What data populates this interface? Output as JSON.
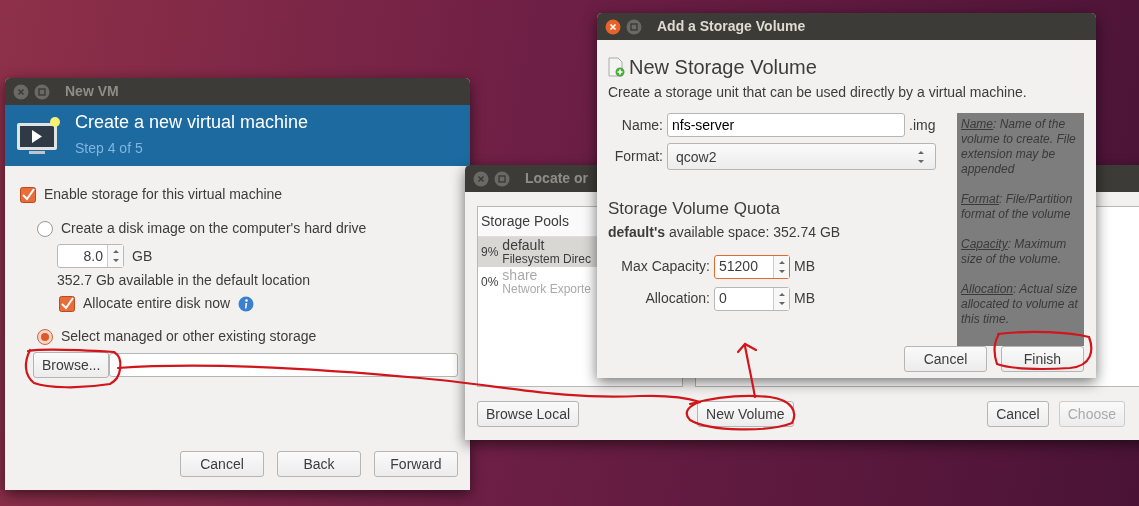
{
  "new_vm_window": {
    "title": "New VM",
    "active": false,
    "header": {
      "title": "Create a new virtual machine",
      "subtitle": "Step 4 of 5"
    },
    "enable_storage": {
      "label": "Enable storage for this virtual machine",
      "checked": true
    },
    "create_disk": {
      "label": "Create a disk image on the computer's hard drive",
      "selected": false
    },
    "disk_size": {
      "value": "8.0",
      "unit": "GB"
    },
    "available": "352.7 Gb available in the default location",
    "allocate": {
      "label": "Allocate entire disk now",
      "checked": true
    },
    "existing_storage": {
      "label": "Select managed or other existing storage",
      "selected": true
    },
    "browse_button": "Browse...",
    "buttons": [
      "Cancel",
      "Back",
      "Forward"
    ]
  },
  "locate_window": {
    "title": "Locate or",
    "active": false,
    "storage_pools": {
      "heading": "Storage Pools",
      "items": [
        {
          "usage": "9%",
          "name": "default",
          "type": "Filesystem Direc",
          "selected": true,
          "disabled": false
        },
        {
          "usage": "0%",
          "name": "share",
          "type": "Network Exporte",
          "selected": false,
          "disabled": true
        }
      ]
    },
    "left_buttons": [
      {
        "label": "Browse Local",
        "disabled": false
      },
      {
        "label": "New Volume",
        "disabled": false
      }
    ],
    "right_buttons": [
      {
        "label": "Cancel",
        "disabled": false
      },
      {
        "label": "Choose",
        "disabled": true
      }
    ]
  },
  "add_volume_window": {
    "title": "Add a Storage Volume",
    "active": true,
    "heading": "New Storage Volume",
    "description": "Create a storage unit that can be used directly by a virtual machine.",
    "name_field": {
      "label": "Name:",
      "value": "nfs-server",
      "suffix": ".img"
    },
    "format_field": {
      "label": "Format:",
      "value": "qcow2"
    },
    "quota_heading": "Storage Volume Quota",
    "available": "**default's** available space: 352.74 GB",
    "quota_fields": [
      {
        "label": "Max Capacity:",
        "value": "51200",
        "unit": "MB",
        "focused": true
      },
      {
        "label": "Allocation:",
        "value": "0",
        "unit": "MB",
        "focused": false
      }
    ],
    "help": [
      {
        "term": "Name",
        "text": ": Name of the volume to create. File extension may be appended"
      },
      {
        "term": "Format",
        "text": ": File/Partition format of the volume"
      },
      {
        "term": "Capacity",
        "text": ": Maximum size of the volume."
      },
      {
        "term": "Allocation",
        "text": ": Actual size allocated to volume at this time."
      }
    ],
    "buttons": [
      "Cancel",
      "Finish"
    ]
  }
}
